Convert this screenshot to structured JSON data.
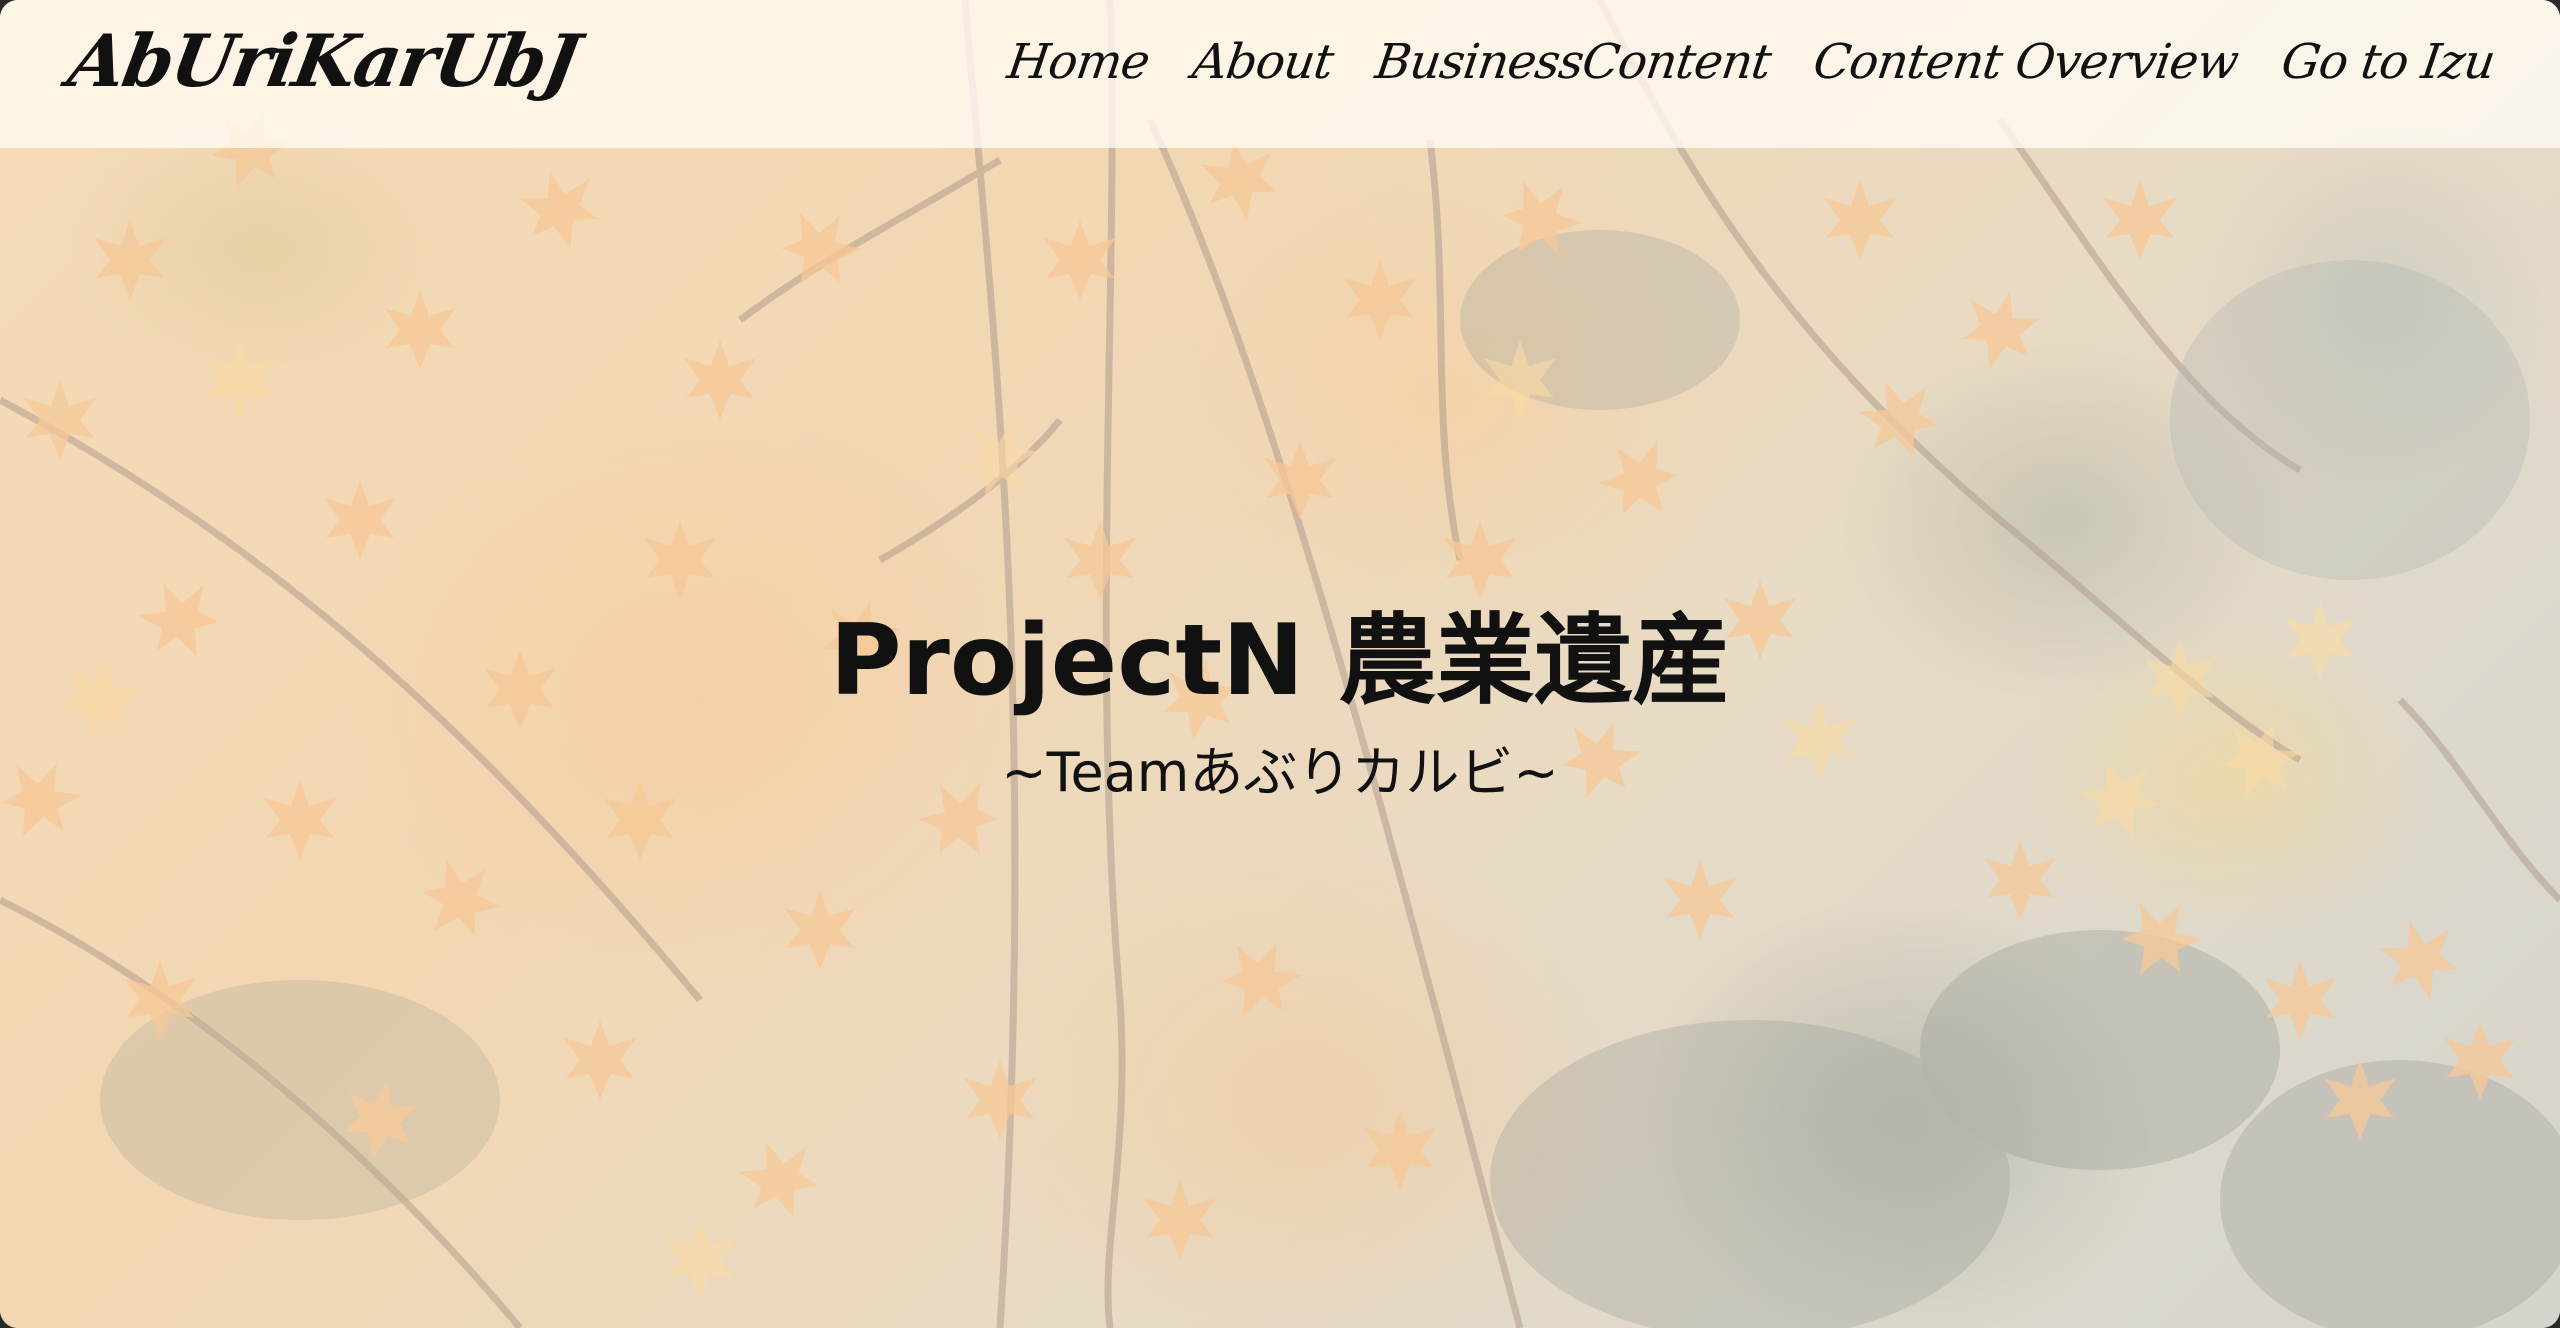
{
  "header": {
    "logo_text": "AbUriKarUbJ",
    "nav": [
      {
        "label": "Home"
      },
      {
        "label": "About"
      },
      {
        "label": "BusinessContent"
      },
      {
        "label": "Content Overview"
      },
      {
        "label": "Go to Izu"
      }
    ]
  },
  "hero": {
    "title": "ProjectN 農業遺産",
    "subtitle": "~Teamあぶりカルビ~",
    "background_image": "autumn maple leaves"
  },
  "colors": {
    "text": "#111111",
    "header_bg": "#fffbf4",
    "leaf_orange": "#eba35a"
  }
}
